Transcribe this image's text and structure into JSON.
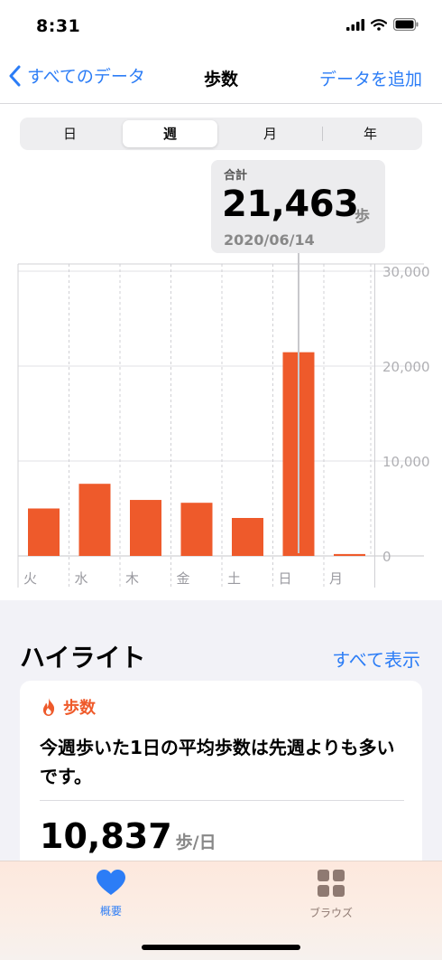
{
  "status": {
    "time": "8:31"
  },
  "nav": {
    "back_label": "すべてのデータ",
    "title": "歩数",
    "add_label": "データを追加"
  },
  "segments": [
    "日",
    "週",
    "月",
    "年"
  ],
  "selected_segment": "週",
  "tooltip": {
    "label": "合計",
    "value": "21,463",
    "unit": "歩",
    "date": "2020/06/14"
  },
  "chart_data": {
    "type": "bar",
    "categories": [
      "火",
      "水",
      "木",
      "金",
      "土",
      "日",
      "月"
    ],
    "values": [
      5000,
      7600,
      5900,
      5600,
      4000,
      21463,
      200
    ],
    "ylim": [
      0,
      30000
    ],
    "yticks": [
      "0",
      "10,000",
      "20,000",
      "30,000"
    ],
    "grid": true,
    "bar_color": "#ee5a2b",
    "highlighted_category": "日"
  },
  "highlights": {
    "title": "ハイライト",
    "see_all": "すべて表示",
    "card": {
      "icon": "flame-icon",
      "category": "歩数",
      "text": "今週歩いた1日の平均歩数は先週よりも多いです。",
      "value": "10,837",
      "unit": "歩/日"
    }
  },
  "tabs": [
    {
      "label": "概要",
      "icon": "heart-icon",
      "active": true
    },
    {
      "label": "ブラウズ",
      "icon": "grid-icon",
      "active": false
    }
  ],
  "colors": {
    "accent": "#2c7df6",
    "orange": "#ee5a2b",
    "tab_active": "#2c7df6",
    "tab_inactive": "#8f7a72"
  }
}
